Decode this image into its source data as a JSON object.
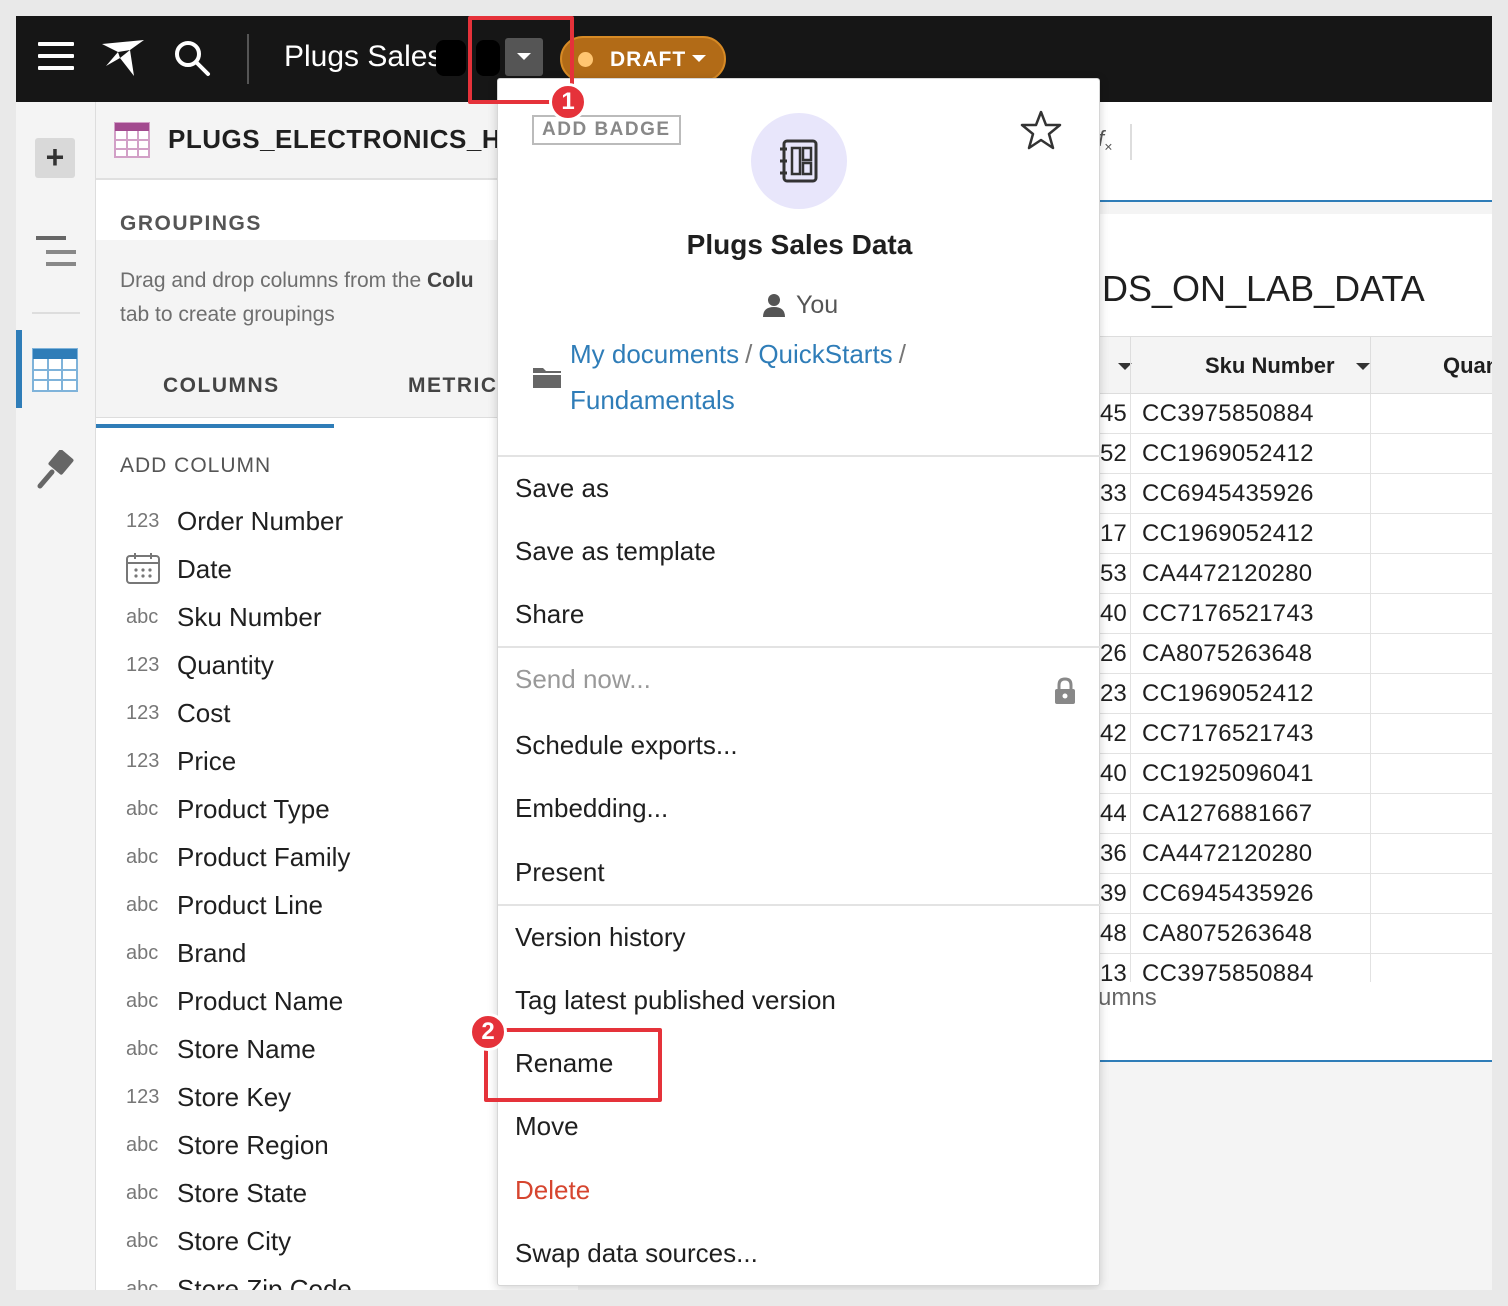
{
  "app": {
    "doc_title": "Plugs Sales",
    "status_badge": "DRAFT",
    "colors": {
      "topbar": "#161616",
      "accent": "#2f7db8",
      "draft": "#b26b17",
      "danger": "#d6452f",
      "annotation": "#e5323a"
    }
  },
  "panel": {
    "title": "PLUGS_ELECTRONICS_HA...",
    "groupings_heading": "GROUPINGS",
    "groupings_hint_pre": "Drag and drop columns from the ",
    "groupings_hint_bold": "Colu",
    "groupings_hint_post": "tab to create groupings",
    "tabs": [
      "COLUMNS",
      "METRICS"
    ],
    "add_column": "ADD COLUMN",
    "columns": [
      {
        "type": "123",
        "name": "Order Number"
      },
      {
        "type": "date-icon",
        "name": "Date"
      },
      {
        "type": "abc",
        "name": "Sku Number"
      },
      {
        "type": "123",
        "name": "Quantity"
      },
      {
        "type": "123",
        "name": "Cost"
      },
      {
        "type": "123",
        "name": "Price"
      },
      {
        "type": "abc",
        "name": "Product Type"
      },
      {
        "type": "abc",
        "name": "Product Family"
      },
      {
        "type": "abc",
        "name": "Product Line"
      },
      {
        "type": "abc",
        "name": "Brand"
      },
      {
        "type": "abc",
        "name": "Product Name"
      },
      {
        "type": "abc",
        "name": "Store Name"
      },
      {
        "type": "123",
        "name": "Store Key"
      },
      {
        "type": "abc",
        "name": "Store Region"
      },
      {
        "type": "abc",
        "name": "Store State"
      },
      {
        "type": "abc",
        "name": "Store City"
      },
      {
        "type": "abc",
        "name": "Store Zip Code"
      }
    ]
  },
  "sheet": {
    "fx_label": "fx",
    "title": "DS_ON_LAB_DATA",
    "headers": [
      "Sku Number",
      "Quant"
    ],
    "rows": [
      [
        "45",
        "CC3975850884"
      ],
      [
        "52",
        "CC1969052412"
      ],
      [
        "33",
        "CC6945435926"
      ],
      [
        "17",
        "CC1969052412"
      ],
      [
        "53",
        "CA4472120280"
      ],
      [
        "40",
        "CC7176521743"
      ],
      [
        "26",
        "CA8075263648"
      ],
      [
        "23",
        "CC1969052412"
      ],
      [
        "42",
        "CC7176521743"
      ],
      [
        "40",
        "CC1925096041"
      ],
      [
        "44",
        "CA1276881667"
      ],
      [
        "36",
        "CA4472120280"
      ],
      [
        "39",
        "CC6945435926"
      ],
      [
        "48",
        "CA8075263648"
      ],
      [
        "13",
        "CC3975850884"
      ]
    ],
    "footer_fragment": "umns"
  },
  "menu": {
    "add_badge": "ADD BADGE",
    "doc_name": "Plugs Sales Data",
    "owner": "You",
    "path": [
      "My documents",
      "QuickStarts",
      "Fundamentals"
    ],
    "items": {
      "save_as": "Save as",
      "save_as_template": "Save as template",
      "share": "Share",
      "send_now": "Send now...",
      "schedule_exports": "Schedule exports...",
      "embedding": "Embedding...",
      "present": "Present",
      "version_history": "Version history",
      "tag_latest": "Tag latest published version",
      "rename": "Rename",
      "move": "Move",
      "delete": "Delete",
      "swap": "Swap data sources..."
    }
  },
  "annotations": {
    "step1": "1",
    "step2": "2"
  }
}
